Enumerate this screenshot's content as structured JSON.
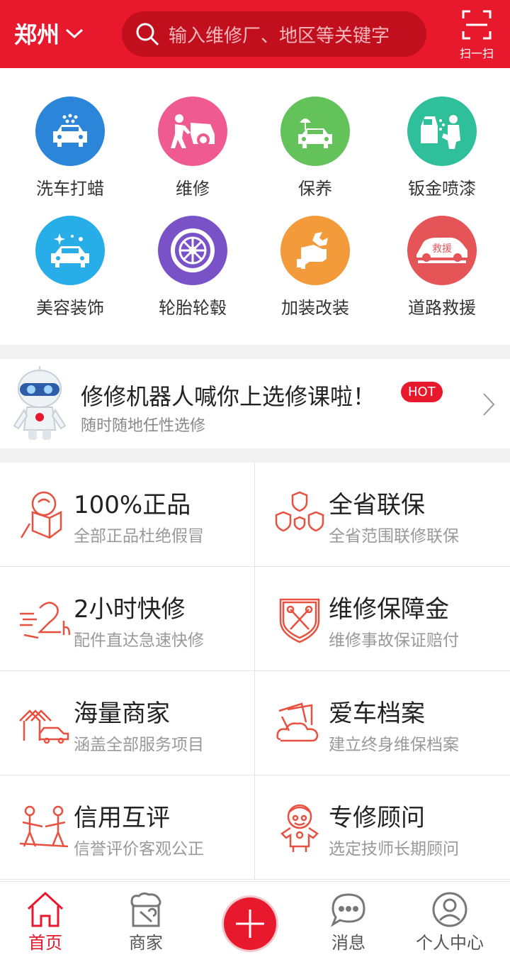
{
  "header": {
    "city": "郑州",
    "search_placeholder": "输入维修厂、地区等关键字",
    "scan_label": "扫一扫"
  },
  "categories": [
    {
      "label": "洗车打蜡",
      "icon": "car-wash-icon",
      "color": "#2b86d9"
    },
    {
      "label": "维修",
      "icon": "repair-icon",
      "color": "#ef5b8f"
    },
    {
      "label": "保养",
      "icon": "maintenance-icon",
      "color": "#63c25a"
    },
    {
      "label": "钣金喷漆",
      "icon": "paint-icon",
      "color": "#2fbf9a"
    },
    {
      "label": "美容装饰",
      "icon": "beauty-icon",
      "color": "#27aee8"
    },
    {
      "label": "轮胎轮毂",
      "icon": "tire-icon",
      "color": "#7a52c7"
    },
    {
      "label": "加装改装",
      "icon": "modify-icon",
      "color": "#f39a3b"
    },
    {
      "label": "道路救援",
      "icon": "rescue-icon",
      "color": "#e55456"
    }
  ],
  "rescue_badge": "救援",
  "promo": {
    "title": "修修机器人喊你上选修课啦！",
    "badge": "HOT",
    "subtitle": "随时随地任性选修"
  },
  "features": [
    {
      "title": "100%正品",
      "subtitle": "全部正品杜绝假冒",
      "icon": "genuine-icon"
    },
    {
      "title": "全省联保",
      "subtitle": "全省范围联修联保",
      "icon": "shields-icon"
    },
    {
      "title": "2小时快修",
      "subtitle": "配件直达急速快修",
      "icon": "fast-repair-icon"
    },
    {
      "title": "维修保障金",
      "subtitle": "维修事故保证赔付",
      "icon": "guarantee-icon"
    },
    {
      "title": "海量商家",
      "subtitle": "涵盖全部服务项目",
      "icon": "merchants-icon"
    },
    {
      "title": "爱车档案",
      "subtitle": "建立终身维保档案",
      "icon": "archive-icon"
    },
    {
      "title": "信用互评",
      "subtitle": "信誉评价客观公正",
      "icon": "credit-icon"
    },
    {
      "title": "专修顾问",
      "subtitle": "选定技师长期顾问",
      "icon": "advisor-icon"
    }
  ],
  "nav": {
    "home": "首页",
    "merchants": "商家",
    "messages": "消息",
    "profile": "个人中心"
  },
  "colors": {
    "brand": "#e8192c",
    "feature_icon": "#e8503f"
  }
}
